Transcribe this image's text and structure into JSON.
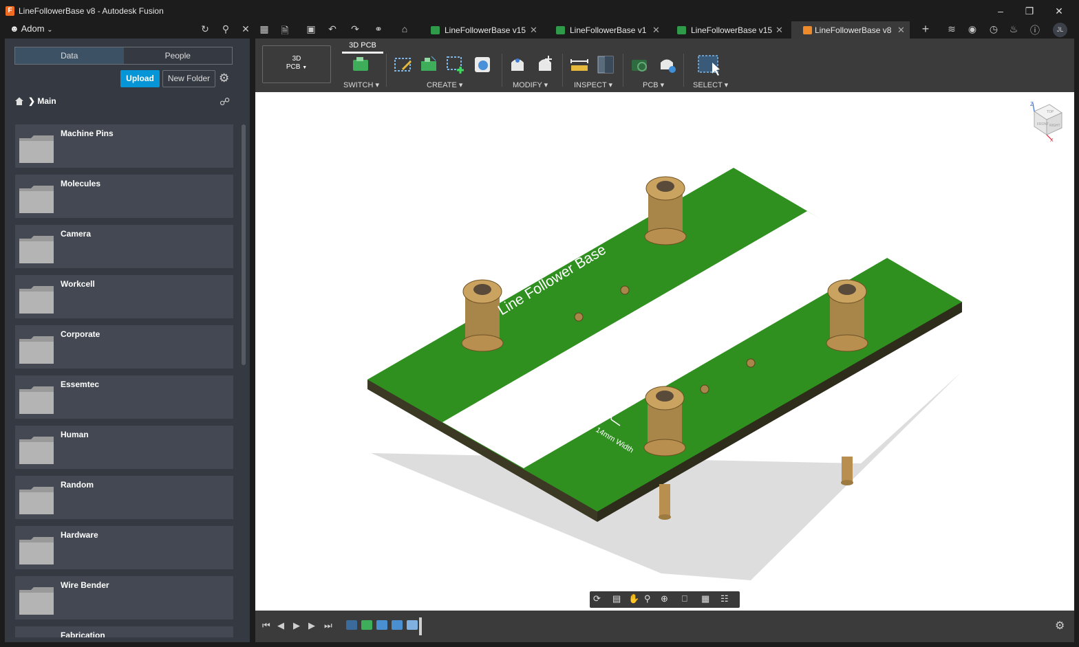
{
  "window": {
    "title": "LineFollowerBase v8 - Autodesk Fusion",
    "app_icon": "F"
  },
  "team": {
    "name": "Adom"
  },
  "tabs": [
    {
      "label": "LineFollowerBase v15",
      "active": false
    },
    {
      "label": "LineFollowerBase v1",
      "active": false
    },
    {
      "label": "LineFollowerBase v15",
      "active": false
    },
    {
      "label": "LineFollowerBase v8",
      "active": true
    }
  ],
  "user": {
    "initials": "JL"
  },
  "data_panel": {
    "tabs": [
      "Data",
      "People"
    ],
    "active_tab": "Data",
    "upload_label": "Upload",
    "new_folder_label": "New Folder",
    "breadcrumb": "Main",
    "folders": [
      "Machine Pins",
      "Molecules",
      "Camera",
      "Workcell",
      "Corporate",
      "Essemtec",
      "Human",
      "Random",
      "Hardware",
      "Wire Bender",
      "Fabrication"
    ]
  },
  "toolbar": {
    "workspace_l1": "3D",
    "workspace_l2": "PCB",
    "workspace_tab": "3D PCB",
    "groups": {
      "switch": "SWITCH",
      "create": "CREATE",
      "modify": "MODIFY",
      "inspect": "INSPECT",
      "pcb": "PCB",
      "select": "SELECT"
    }
  },
  "model": {
    "board_text": "Line Follower Base",
    "width_label": "14mm Width"
  },
  "viewcube": {
    "z": "Z",
    "x": "X",
    "faces": [
      "TOP",
      "FRONT",
      "RIGHT"
    ]
  },
  "colors": {
    "accent": "#0696d7",
    "board": "#2f8f1f",
    "brass": "#b78f4f",
    "orange": "#ef6c23"
  }
}
